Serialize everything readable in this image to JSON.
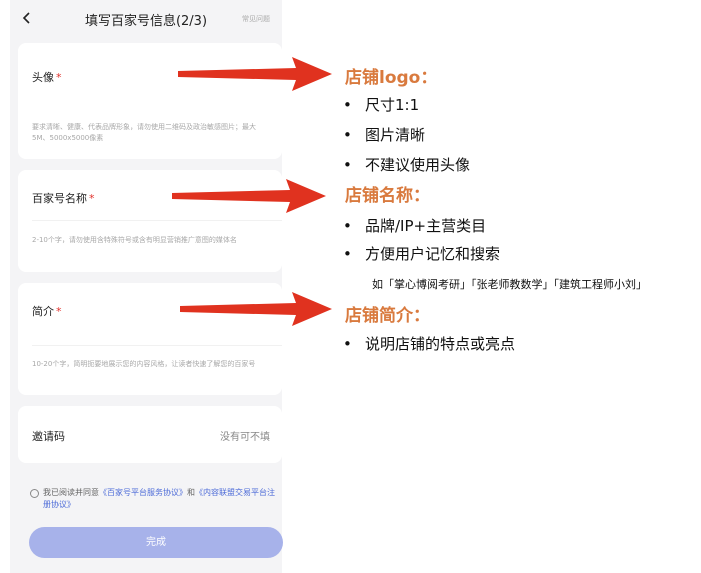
{
  "header": {
    "title": "填写百家号信息(2/3)",
    "faq": "常见问题"
  },
  "form": {
    "avatar": {
      "label": "头像",
      "required_mark": "*",
      "hint": "要求清晰、健康、代表品牌形象，请勿使用二维码及政治敏感图片；最大5M、5000x5000像素"
    },
    "name": {
      "label": "百家号名称",
      "required_mark": "*",
      "hint": "2-10个字，请勿使用含特殊符号或含有明显营销推广意图的媒体名"
    },
    "intro": {
      "label": "简介",
      "required_mark": "*",
      "hint": "10-20个字，简明扼要地展示您的内容风格，让读者快速了解您的百家号"
    },
    "invite": {
      "label": "邀请码",
      "placeholder": "没有可不填"
    }
  },
  "agreement": {
    "prefix": "我已阅读并同意",
    "link1": "《百家号平台服务协议》",
    "and": "和",
    "link2": "《内容联盟交易平台注册协议》"
  },
  "submit_label": "完成",
  "annotations": {
    "logo": {
      "title": "店铺logo：",
      "bullets": [
        "尺寸1:1",
        "图片清晰",
        "不建议使用头像"
      ]
    },
    "name": {
      "title": "店铺名称：",
      "bullets": [
        "品牌/IP+主营类目",
        "方便用户记忆和搜索"
      ],
      "example": "如「掌心博阅考研」「张老师教数学」「建筑工程师小刘」"
    },
    "intro": {
      "title": "店铺简介：",
      "bullets": [
        "说明店铺的特点或亮点"
      ]
    },
    "bullet_symbol": "•"
  },
  "colors": {
    "arrow": "#e0321f",
    "annotation_title": "#d97a3e",
    "submit_button": "#a7b2ea",
    "link": "#4d6bd8",
    "required": "#e0312b"
  }
}
